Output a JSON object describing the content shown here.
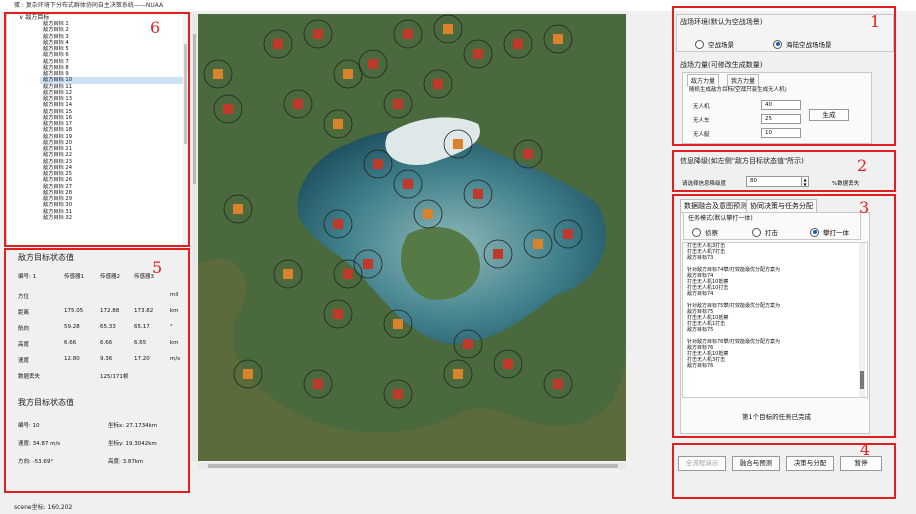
{
  "window": {
    "title": "蛋 : 复杂环境下分布式群体协同自主决策系统——NUAA"
  },
  "tree": {
    "root_label": "敌方目标",
    "items": [
      "敌方目标 1",
      "敌方目标 2",
      "敌方目标 3",
      "敌方目标 4",
      "敌方目标 5",
      "敌方目标 6",
      "敌方目标 7",
      "敌方目标 8",
      "敌方目标 9",
      "敌方目标 10",
      "敌方目标 11",
      "敌方目标 12",
      "敌方目标 13",
      "敌方目标 14",
      "敌方目标 15",
      "敌方目标 16",
      "敌方目标 17",
      "敌方目标 18",
      "敌方目标 19",
      "敌方目标 20",
      "敌方目标 21",
      "敌方目标 22",
      "敌方目标 23",
      "敌方目标 24",
      "敌方目标 25",
      "敌方目标 26",
      "敌方目标 27",
      "敌方目标 28",
      "敌方目标 29",
      "敌方目标 30",
      "敌方目标 31",
      "敌方目标 32"
    ],
    "selected_index": 9
  },
  "enemy_state": {
    "title": "敌方目标状态值",
    "header": [
      "编号: 1",
      "传感器1",
      "传感器2",
      "传感器3"
    ],
    "rows": [
      {
        "label": "方位",
        "v1": "",
        "v2": "",
        "v3": "",
        "unit": "mil"
      },
      {
        "label": "距离",
        "v1": "175.05",
        "v2": "172.88",
        "v3": "173.82",
        "unit": "km"
      },
      {
        "label": "航向",
        "v1": "59.28",
        "v2": "65.33",
        "v3": "65.17",
        "unit": "°"
      },
      {
        "label": "高度",
        "v1": "6.66",
        "v2": "6.66",
        "v3": "6.65",
        "unit": "km"
      },
      {
        "label": "速度",
        "v1": "12.80",
        "v2": "9.36",
        "v3": "17.20",
        "unit": "m/s"
      }
    ],
    "loss_label": "数据丢失",
    "loss_value": "125/171帧"
  },
  "mine_state": {
    "title": "我方目标状态值",
    "id": "编号: 10",
    "x": "坐标x: 27.1734km",
    "speed": "速度: 34.87 m/s",
    "y": "坐标y: 19.3042km",
    "heading": "方向: -53.69°",
    "altitude": "高度: 3.87km"
  },
  "status_bar": "scene坐标: 160,202",
  "panel1": {
    "env_title": "战场环境(默认为空战场景)",
    "env_options": [
      "空战场景",
      "海陆空战场场景"
    ],
    "env_selected": 1,
    "force_title": "战场力量(可修改生成数量)",
    "tabs": [
      "敌方力量",
      "我方力量"
    ],
    "random_label": "随机生成敌方目标(空战只会生成无人机)",
    "fields": [
      {
        "label": "无人机",
        "value": "40"
      },
      {
        "label": "无人车",
        "value": "25"
      },
      {
        "label": "无人艇",
        "value": "10"
      }
    ],
    "generate_label": "生成"
  },
  "panel2": {
    "title": "信息降级(如左侧\"敌方目标状态值\"所示)",
    "label": "请选择信息降级度",
    "value": "80",
    "suffix": "%数据丢失"
  },
  "panel3": {
    "tabs": [
      "数据融合及意图预测",
      "协同决策与任务分配"
    ],
    "mode_title": "任务模式(默认攀打一体)",
    "modes": [
      "侦察",
      "打击",
      "攀打一体"
    ],
    "mode_selected": 2,
    "log": [
      "打击无人机3打击",
      "打击无人机7打击",
      "敌方目标73",
      "",
      "针对敌方目标74攀/打效能最优分配方案为",
      "敌方目标74",
      "打击无人机10抵察",
      "打击无人机10打击",
      "敌方目标74",
      "",
      "针对敌方目标75攀/打效能最优分配方案为",
      "敌方目标75",
      "打击无人机10抵察",
      "打击无人机1打击",
      "敌方目标75",
      "",
      "针对敌方目标76攀/打效能最优分配方案为",
      "敌方目标76",
      "打击无人机10抵察",
      "打击无人机3打击",
      "敌方目标76"
    ],
    "done_text": "第1个目标的任务已完成"
  },
  "panel4": {
    "buttons": [
      "全流程演示",
      "融合与预测",
      "决策与分配",
      "暂停"
    ]
  },
  "annotations": [
    "1",
    "2",
    "3",
    "4",
    "5",
    "6"
  ]
}
